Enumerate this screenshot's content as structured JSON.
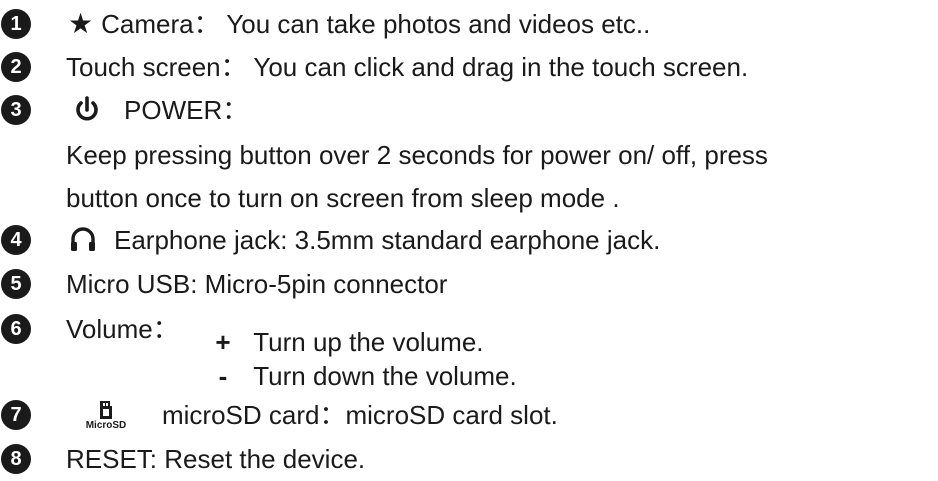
{
  "items": [
    {
      "number": "1",
      "prefix_icon": "star-icon",
      "text": "Camera： You can take photos and videos etc.."
    },
    {
      "number": "2",
      "text": "Touch screen： You can click and drag in the touch screen."
    },
    {
      "number": "3",
      "prefix_icon": "power-icon",
      "text": "POWER："
    },
    {
      "continuation_1": "Keep pressing button over 2 seconds for power on/ off, press",
      "continuation_2": "button once to turn on screen from sleep mode ."
    },
    {
      "number": "4",
      "prefix_icon": "headphone-icon",
      "text": "Earphone jack: 3.5mm standard earphone jack."
    },
    {
      "number": "5",
      "text": "Micro USB: Micro-5pin connector"
    },
    {
      "number": "6",
      "text": "Volume：",
      "plus_symbol": "+",
      "plus_text": "Turn up the volume.",
      "minus_symbol": "-",
      "minus_text": "Turn down the volume."
    },
    {
      "number": "7",
      "prefix_icon": "microsd-icon",
      "icon_label": "MicroSD",
      "text": "microSD card：microSD card slot."
    },
    {
      "number": "8",
      "text": "RESET: Reset the device."
    }
  ]
}
